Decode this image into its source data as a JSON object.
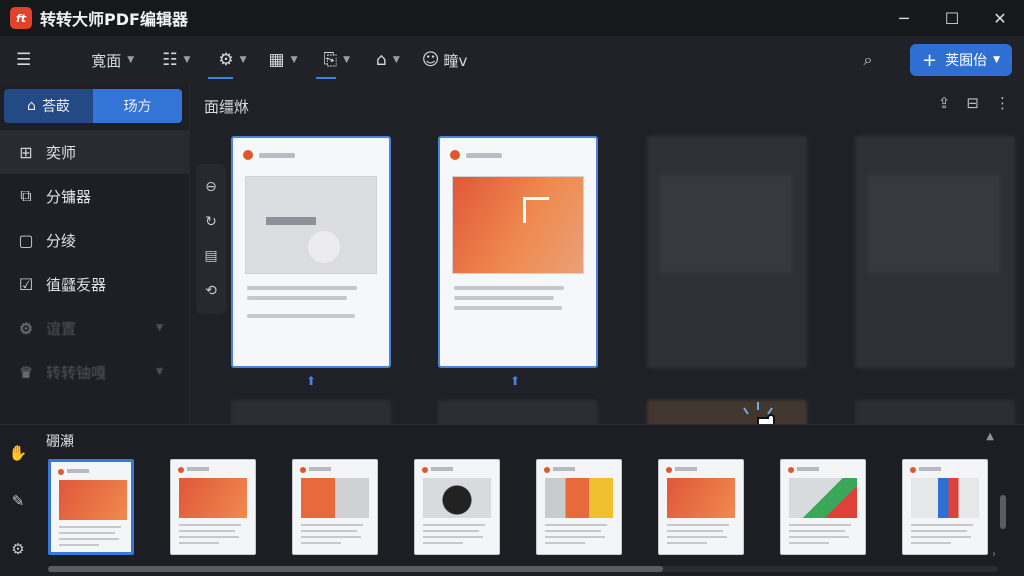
{
  "app": {
    "logo_text": "ft",
    "title": "转转大师PDF编辑器"
  },
  "window_controls": {
    "minimize": "─",
    "maximize": "☐",
    "close": "✕"
  },
  "toolbar": {
    "menu_icon": "menu-icon",
    "page_menu_label": "寛面",
    "items": [
      {
        "name": "list-tool",
        "icon": "☷"
      },
      {
        "name": "settings-tool",
        "icon": "⚙"
      },
      {
        "name": "grid-tool",
        "icon": "▦"
      },
      {
        "name": "page-tool",
        "icon": "⎘"
      },
      {
        "name": "scan-tool",
        "icon": "⌂"
      }
    ],
    "user_label": "疃v",
    "primary_button": "荚囿佁"
  },
  "sidebar": {
    "segments": [
      {
        "label": "荅菣",
        "icon": "home-icon",
        "active": false
      },
      {
        "label": "玚方",
        "icon": "",
        "active": true
      }
    ],
    "items": [
      {
        "label": "奕师",
        "icon": "grid-icon",
        "selected": true,
        "dim": false
      },
      {
        "label": "分镛器",
        "icon": "split-icon",
        "selected": false,
        "dim": false
      },
      {
        "label": "分绫",
        "icon": "frame-icon",
        "selected": false,
        "dim": false
      },
      {
        "label": "徝瓥叐器",
        "icon": "edit-icon",
        "selected": false,
        "dim": false
      },
      {
        "label": "谊置",
        "icon": "settings-icon",
        "selected": false,
        "dim": true
      },
      {
        "label": "转转铀嘎",
        "icon": "crown-icon",
        "selected": false,
        "dim": true
      }
    ]
  },
  "main": {
    "title": "面缰烌"
  },
  "thumbnails": {
    "title": "硼瀬",
    "count": 8
  },
  "colors": {
    "accent": "#3474d6",
    "brand": "#e0432a",
    "background": "#1b1d22"
  }
}
